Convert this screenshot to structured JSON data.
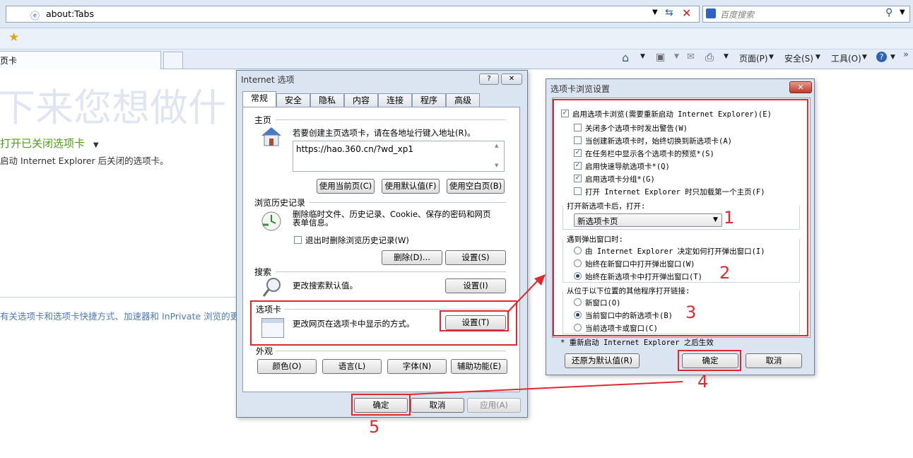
{
  "browser": {
    "address": "about:Tabs",
    "search_placeholder": "百度搜索",
    "tab_label": "页卡",
    "commands": {
      "page": "页面(P)",
      "safety": "安全(S)",
      "tools": "工具(O)"
    }
  },
  "newtab_page": {
    "heading": "下来您想做什",
    "reopen_link": "打开已关闭选项卡",
    "reopen_desc": "启动 Internet Explorer 后关闭的选项卡。",
    "footer_link": "有关选项卡和选项卡快捷方式、加速器和 InPrivate 浏览的更"
  },
  "internet_options": {
    "title": "Internet 选项",
    "tabs": [
      "常规",
      "安全",
      "隐私",
      "内容",
      "连接",
      "程序",
      "高级"
    ],
    "homepage": {
      "label": "主页",
      "desc": "若要创建主页选项卡，请在各地址行键入地址(R)。",
      "url": "https://hao.360.cn/?wd_xp1",
      "btn_current": "使用当前页(C)",
      "btn_default": "使用默认值(F)",
      "btn_blank": "使用空白页(B)"
    },
    "history": {
      "label": "浏览历史记录",
      "desc": "删除临时文件、历史记录、Cookie、保存的密码和网页表单信息。",
      "checkbox": "退出时删除浏览历史记录(W)",
      "btn_delete": "删除(D)...",
      "btn_settings": "设置(S)"
    },
    "search": {
      "label": "搜索",
      "desc": "更改搜索默认值。",
      "btn_settings": "设置(I)"
    },
    "tabs_group": {
      "label": "选项卡",
      "desc": "更改网页在选项卡中显示的方式。",
      "btn_settings": "设置(T)"
    },
    "appearance": {
      "label": "外观",
      "btn_colors": "颜色(O)",
      "btn_languages": "语言(L)",
      "btn_fonts": "字体(N)",
      "btn_accessibility": "辅助功能(E)"
    },
    "ok": "确定",
    "cancel": "取消",
    "apply": "应用(A)"
  },
  "tab_settings": {
    "title": "选项卡浏览设置",
    "enable_tabs": "启用选项卡浏览(需要重新启动 Internet Explorer)(E)",
    "options": [
      {
        "label": "关闭多个选项卡时发出警告(W)",
        "checked": false
      },
      {
        "label": "当创建新选项卡时，始终切换到新选项卡(A)",
        "checked": false
      },
      {
        "label": "在任务栏中显示各个选项卡的预览*(S)",
        "checked": true
      },
      {
        "label": "启用快速导航选项卡*(Q)",
        "checked": true
      },
      {
        "label": "启用选项卡分组*(G)",
        "checked": true
      },
      {
        "label": "打开 Internet Explorer 时只加载第一个主页(F)",
        "checked": false
      }
    ],
    "open_new_label": "打开新选项卡后，打开:",
    "open_new_value": "新选项卡页",
    "popup_label": "遇到弹出窗口时:",
    "popup_options": [
      {
        "label": "由 Internet Explorer 决定如何打开弹出窗口(I)",
        "selected": false
      },
      {
        "label": "始终在新窗口中打开弹出窗口(W)",
        "selected": false
      },
      {
        "label": "始终在新选项卡中打开弹出窗口(T)",
        "selected": true
      }
    ],
    "links_label": "从位于以下位置的其他程序打开链接:",
    "links_options": [
      {
        "label": "新窗口(O)",
        "selected": false
      },
      {
        "label": "当前窗口中的新选项卡(B)",
        "selected": true
      },
      {
        "label": "当前选项卡或窗口(C)",
        "selected": false
      }
    ],
    "note": "* 重新启动 Internet Explorer 之后生效",
    "restore": "还原为默认值(R)",
    "ok": "确定",
    "cancel": "取消"
  },
  "annotations": [
    "1",
    "2",
    "3",
    "4",
    "5"
  ],
  "colors": {
    "accent_red": "#e0282f",
    "link_green": "#4aa014"
  }
}
